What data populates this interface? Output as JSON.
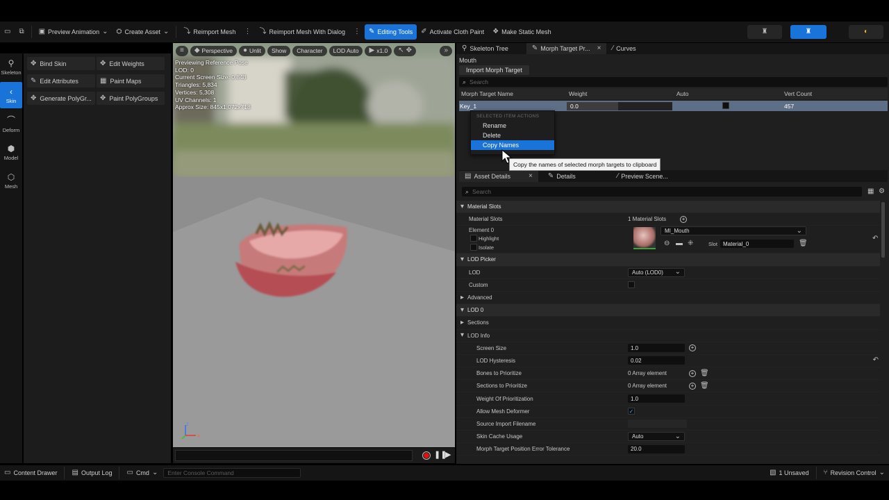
{
  "toolbar": {
    "preview_animation": "Preview Animation",
    "create_asset": "Create Asset",
    "reimport_mesh": "Reimport Mesh",
    "reimport_mesh_dialog": "Reimport Mesh With Dialog",
    "editing_tools": "Editing Tools",
    "activate_cloth_paint": "Activate Cloth Paint",
    "make_static_mesh": "Make Static Mesh"
  },
  "modes": [
    {
      "label": "Skeleton",
      "icon": "skeleton-icon"
    },
    {
      "label": "Skin",
      "icon": "skin-icon"
    },
    {
      "label": "Deform",
      "icon": "deform-icon"
    },
    {
      "label": "Model",
      "icon": "model-icon"
    },
    {
      "label": "Mesh",
      "icon": "mesh-icon"
    }
  ],
  "tools": {
    "bind_skin": "Bind Skin",
    "edit_weights": "Edit Weights",
    "edit_attributes": "Edit Attributes",
    "paint_maps": "Paint Maps",
    "generate_polygroups": "Generate PolyGr...",
    "paint_polygroups": "Paint PolyGroups"
  },
  "viewport": {
    "perspective": "Perspective",
    "unlit": "Unlit",
    "show": "Show",
    "character": "Character",
    "lod_auto": "LOD Auto",
    "speed": "x1.0",
    "info": [
      "Previewing Reference Pose",
      "LOD: 0",
      "Current Screen Size: 0.848",
      "Triangles: 5,834",
      "Vertices: 5,308",
      "UV Channels: 1",
      "Approx Size: 845x1,072x718"
    ],
    "axis_x": "x",
    "axis_z": "z"
  },
  "morph_panel": {
    "tabs": [
      "Skeleton Tree",
      "Morph Target Pr...",
      "Curves"
    ],
    "mesh_name": "Mouth",
    "import_button": "Import Morph Target",
    "search_placeholder": "Search",
    "columns": [
      "Morph Target Name",
      "Weight",
      "Auto",
      "Vert Count"
    ],
    "row": {
      "name": "Key_1",
      "weight": "0.0",
      "vert_count": "457"
    }
  },
  "context_menu": {
    "section_title": "SELECTED ITEM ACTIONS",
    "items": [
      "Rename",
      "Delete",
      "Copy Names"
    ],
    "tooltip": "Copy the names of selected morph targets to clipboard"
  },
  "details_panel": {
    "tabs": [
      "Asset Details",
      "Details",
      "Preview Scene..."
    ],
    "search_placeholder": "Search",
    "material_slots_cat": "Material Slots",
    "material_slots_label": "Material Slots",
    "material_slots_value": "1 Material Slots",
    "element_label": "Element 0",
    "highlight_label": "Highlight",
    "isolate_label": "Isolate",
    "material_name": "MI_Mouth",
    "slot_label": "Slot",
    "slot_value": "Material_0",
    "lod_picker_cat": "LOD Picker",
    "lod_label": "LOD",
    "lod_value": "Auto (LOD0)",
    "custom_label": "Custom",
    "advanced_label": "Advanced",
    "lod0_cat": "LOD 0",
    "sections_label": "Sections",
    "lod_info_label": "LOD Info",
    "screen_size_label": "Screen Size",
    "screen_size_value": "1.0",
    "lod_hysteresis_label": "LOD Hysteresis",
    "lod_hysteresis_value": "0.02",
    "bones_label": "Bones to Prioritize",
    "bones_value": "0 Array element",
    "sections_prio_label": "Sections to Prioritize",
    "sections_prio_value": "0 Array element",
    "weight_prio_label": "Weight Of Prioritization",
    "weight_prio_value": "1.0",
    "allow_deformer_label": "Allow Mesh Deformer",
    "source_import_label": "Source Import Filename",
    "skin_cache_label": "Skin Cache Usage",
    "skin_cache_value": "Auto",
    "morph_tolerance_label": "Morph Target Position Error Tolerance",
    "morph_tolerance_value": "20.0"
  },
  "statusbar": {
    "content_drawer": "Content Drawer",
    "output_log": "Output Log",
    "cmd": "Cmd",
    "console_placeholder": "Enter Console Command",
    "unsaved": "1 Unsaved",
    "revision_control": "Revision Control"
  },
  "colors": {
    "accent": "#1a73d9",
    "panel": "#1f1f1f",
    "toolbar": "#151515"
  }
}
